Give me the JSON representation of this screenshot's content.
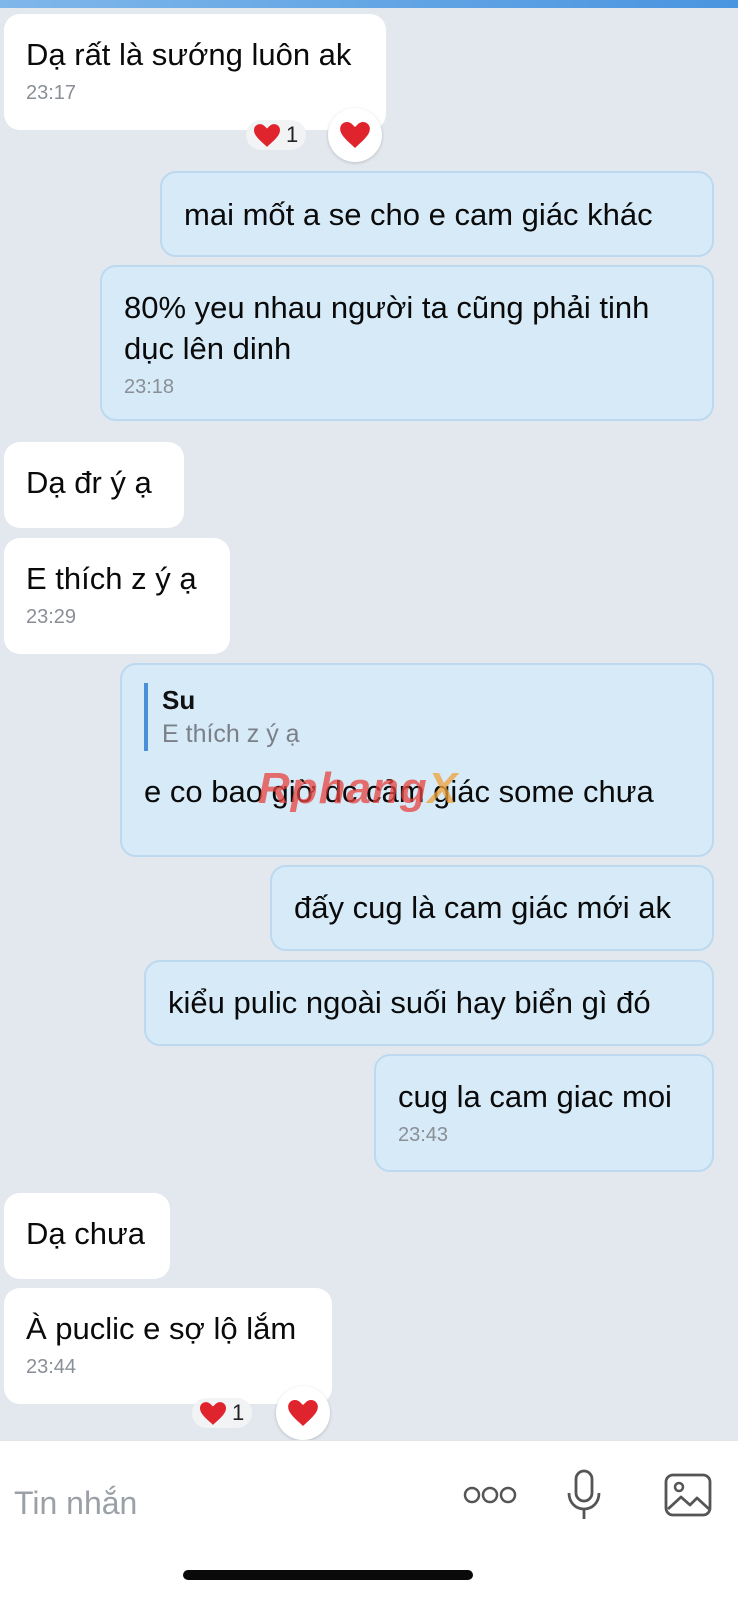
{
  "messages": [
    {
      "text": "Dạ rất là sướng luôn ak",
      "time": "23:17"
    },
    {
      "text": "mai mốt a se cho e cam giác khác"
    },
    {
      "text": "80% yeu nhau người ta cũng phải tinh dục lên dinh",
      "time": "23:18"
    },
    {
      "text": "Dạ đr ý ạ"
    },
    {
      "text": "E thích z ý ạ",
      "time": "23:29"
    },
    {
      "quote_author": "Su",
      "quote_text": "E thích z ý ạ",
      "text": "e co bao giờ dc cảm giác some chưa"
    },
    {
      "text": "đấy cug là cam giác mới ak"
    },
    {
      "text": "kiểu pulic ngoài suối hay biển gì đó"
    },
    {
      "text": "cug la cam giac moi",
      "time": "23:43"
    },
    {
      "text": "Dạ chưa"
    },
    {
      "text": "À puclic e sợ lộ lắm",
      "time": "23:44"
    }
  ],
  "reactions": {
    "first_count": "1",
    "last_count": "1"
  },
  "watermark": {
    "main": "Rphang",
    "x": "X"
  },
  "input": {
    "placeholder": "Tin nhắn"
  },
  "colors": {
    "heart": "#e0242e",
    "outgoing_bubble": "#d6eaf8",
    "incoming_bubble": "#ffffff",
    "background": "#e3e8ee",
    "accent": "#4a90d9"
  },
  "icons": [
    "heart-icon",
    "more-icon",
    "microphone-icon",
    "image-icon"
  ]
}
